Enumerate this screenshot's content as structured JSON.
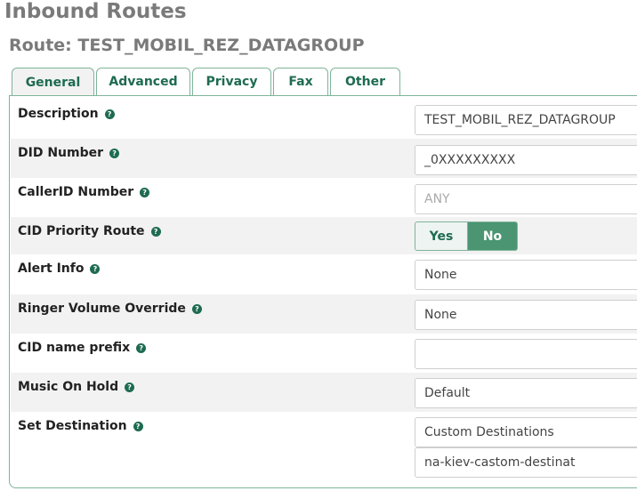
{
  "header": {
    "page_title": "Inbound Routes",
    "route_title": "Route: TEST_MOBIL_REZ_DATAGROUP"
  },
  "tabs": [
    {
      "label": "General",
      "active": true
    },
    {
      "label": "Advanced",
      "active": false
    },
    {
      "label": "Privacy",
      "active": false
    },
    {
      "label": "Fax",
      "active": false
    },
    {
      "label": "Other",
      "active": false
    }
  ],
  "form": {
    "description": {
      "label": "Description",
      "value": "TEST_MOBIL_REZ_DATAGROUP"
    },
    "did_number": {
      "label": "DID Number",
      "value": "_0XXXXXXXXX"
    },
    "callerid_number": {
      "label": "CallerID Number",
      "placeholder": "ANY"
    },
    "cid_priority_route": {
      "label": "CID Priority Route",
      "yes_label": "Yes",
      "no_label": "No",
      "selected": "No"
    },
    "alert_info": {
      "label": "Alert Info",
      "value": "None"
    },
    "ringer_volume_override": {
      "label": "Ringer Volume Override",
      "value": "None"
    },
    "cid_name_prefix": {
      "label": "CID name prefix",
      "value": ""
    },
    "music_on_hold": {
      "label": "Music On Hold",
      "value": "Default"
    },
    "set_destination": {
      "label": "Set Destination",
      "type_value": "Custom Destinations",
      "destination_value": "na-kiev-castom-destinat"
    }
  },
  "help_glyph": "?",
  "colors": {
    "accent": "#1e6b52",
    "toggle_selected": "#4b9572",
    "heading_gray": "#7a7a7a"
  }
}
